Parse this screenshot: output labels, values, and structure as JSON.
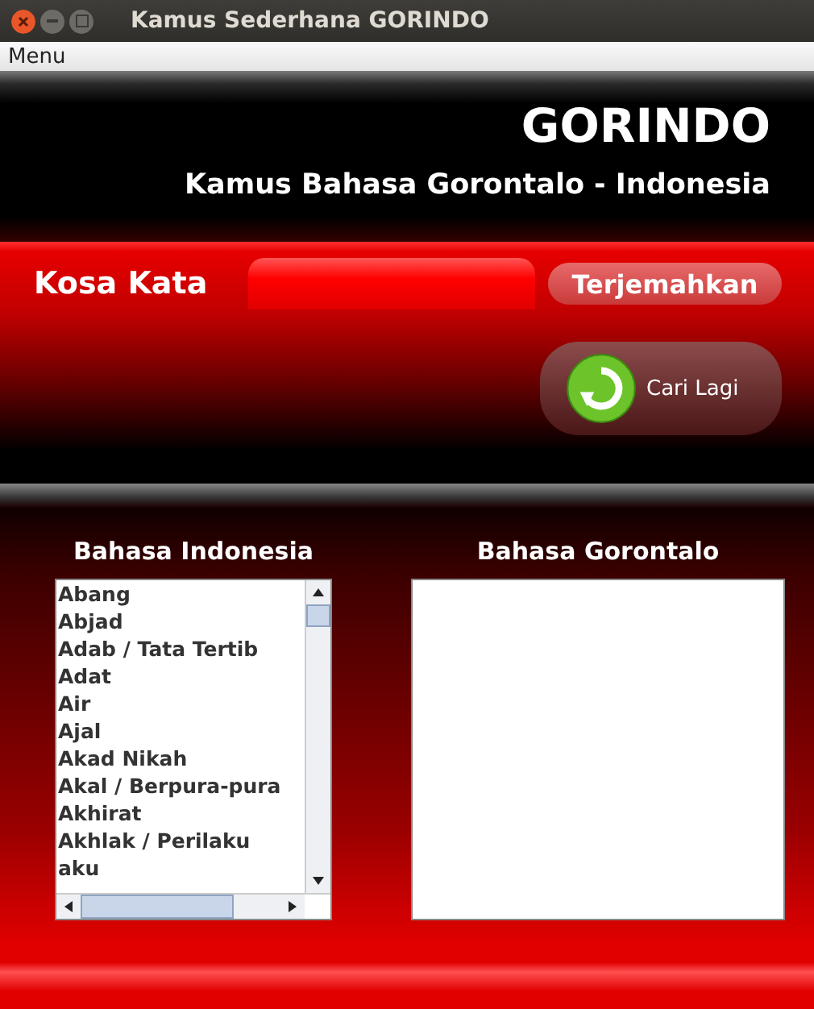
{
  "window": {
    "title": "Kamus Sederhana GORINDO"
  },
  "menu_bar": {
    "items": [
      "Menu"
    ]
  },
  "header": {
    "title": "GORINDO",
    "subtitle": "Kamus Bahasa Gorontalo - Indonesia"
  },
  "search": {
    "label": "Kosa Kata",
    "translate_button": "Terjemahkan",
    "reset_button": "Cari Lagi"
  },
  "indonesian_list": {
    "heading": "Bahasa Indonesia",
    "items": [
      "Abang",
      "Abjad",
      "Adab / Tata Tertib",
      "Adat",
      "Air",
      "Ajal",
      "Akad Nikah",
      "Akal / Berpura-pura",
      "Akhirat",
      "Akhlak / Perilaku",
      "aku"
    ]
  },
  "gorontalo_list": {
    "heading": "Bahasa Gorontalo"
  }
}
